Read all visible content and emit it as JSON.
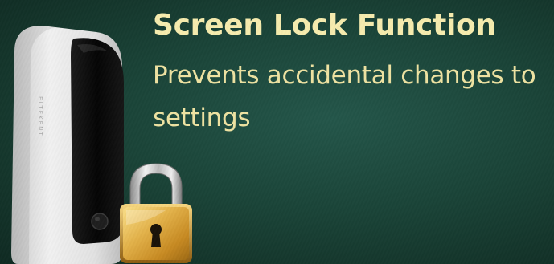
{
  "slide": {
    "title": "Screen Lock Function",
    "subtitle": "Prevents accidental changes to settings",
    "device_brand_text": "ELTEKENT"
  },
  "colors": {
    "background": "#1a4438",
    "title": "#f6ecae",
    "subtitle": "#efe3a2",
    "device_body": "#e6e6e6",
    "device_screen": "#0e0e0e",
    "lock_gold": "#e0b34a"
  },
  "icons": {
    "device": "wall-charger-device",
    "lock": "padlock-icon"
  }
}
